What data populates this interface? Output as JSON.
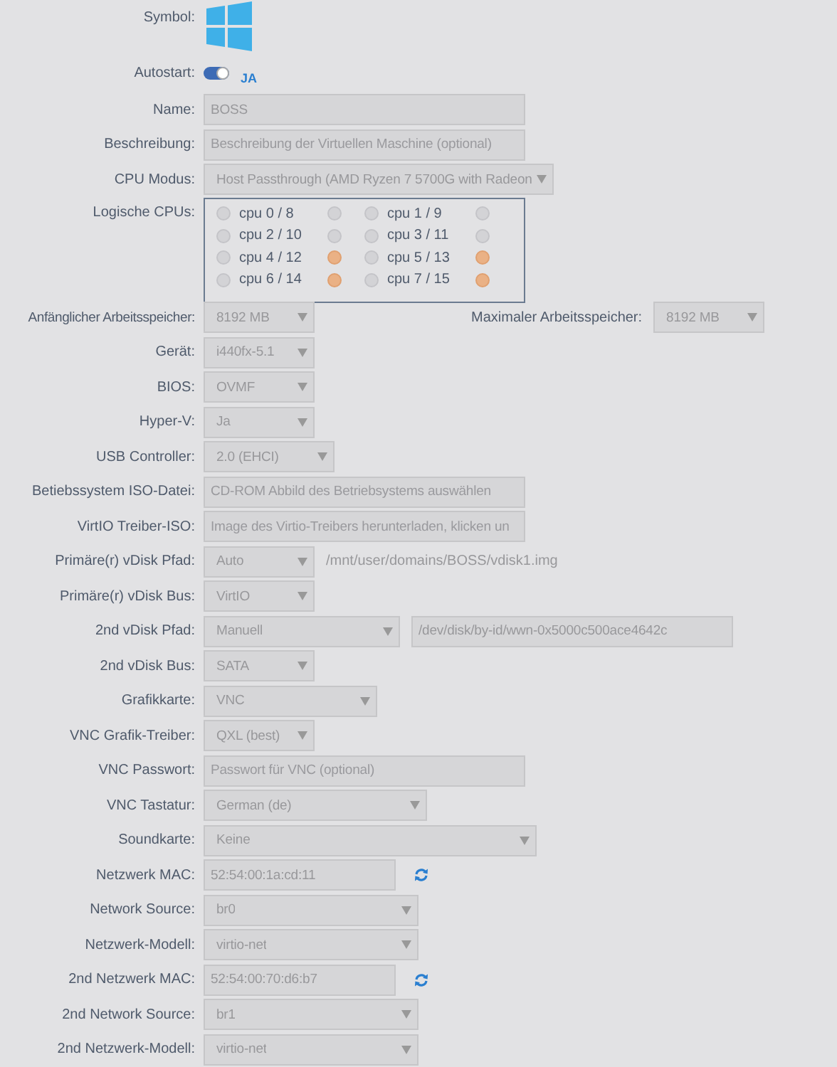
{
  "rows": [
    {
      "kind": "icon",
      "label": "Symbol:"
    },
    {
      "kind": "toggle",
      "label": "Autostart:",
      "on": true,
      "text": "JA"
    },
    {
      "kind": "text",
      "label": "Name:",
      "value": "BOSS"
    },
    {
      "kind": "text",
      "label": "Beschreibung:",
      "placeholder": "Beschreibung der Virtuellen Maschine (optional)"
    },
    {
      "kind": "select",
      "label": "CPU Modus:",
      "value": "Host Passthrough (AMD Ryzen 7 5700G with Radeon"
    },
    {
      "kind": "cpus",
      "label": "Logische CPUs:",
      "cpus": [
        {
          "label": "cpu 0 / 8",
          "first_checked": false,
          "second_checked": false
        },
        {
          "label": "cpu 1 / 9",
          "first_checked": false,
          "second_checked": false
        },
        {
          "label": "cpu 2 / 10",
          "first_checked": false,
          "second_checked": false
        },
        {
          "label": "cpu 3 / 11",
          "first_checked": false,
          "second_checked": false
        },
        {
          "label": "cpu 4 / 12",
          "first_checked": false,
          "second_checked": true
        },
        {
          "label": "cpu 5 / 13",
          "first_checked": false,
          "second_checked": true
        },
        {
          "label": "cpu 6 / 14",
          "first_checked": false,
          "second_checked": true
        },
        {
          "label": "cpu 7 / 15",
          "first_checked": false,
          "second_checked": true
        }
      ]
    },
    {
      "kind": "memory",
      "label": "Anfänglicher Arbeitsspeicher:",
      "value": "8192 MB",
      "second_label": "Maximaler Arbeitsspeicher:",
      "second_value": "8192 MB"
    },
    {
      "kind": "select",
      "label": "Gerät:",
      "value": "i440fx-5.1"
    },
    {
      "kind": "select",
      "label": "BIOS:",
      "value": "OVMF"
    },
    {
      "kind": "select",
      "label": "Hyper-V:",
      "value": "Ja"
    },
    {
      "kind": "select",
      "label": "USB Controller:",
      "value": "2.0 (EHCI)"
    },
    {
      "kind": "text",
      "label": "Betiebssystem ISO-Datei:",
      "placeholder": "CD-ROM Abbild des Betriebsystems auswählen"
    },
    {
      "kind": "text",
      "label": "VirtIO Treiber-ISO:",
      "placeholder": "Image des Virtio-Treibers herunterladen, klicken un"
    },
    {
      "kind": "select_path",
      "label": "Primäre(r) vDisk Pfad:",
      "value": "Auto",
      "path": "/mnt/user/domains/BOSS/vdisk1.img"
    },
    {
      "kind": "select",
      "label": "Primäre(r) vDisk Bus:",
      "value": "VirtIO"
    },
    {
      "kind": "select_input",
      "label": "2nd vDisk Pfad:",
      "value": "Manuell",
      "input_value": "/dev/disk/by-id/wwn-0x5000c500ace4642c"
    },
    {
      "kind": "select",
      "label": "2nd vDisk Bus:",
      "value": "SATA"
    },
    {
      "kind": "select",
      "label": "Grafikkarte:",
      "value": "VNC"
    },
    {
      "kind": "select",
      "label": "VNC Grafik-Treiber:",
      "value": "QXL (best)"
    },
    {
      "kind": "text",
      "label": "VNC Passwort:",
      "placeholder": "Passwort für VNC (optional)"
    },
    {
      "kind": "select",
      "label": "VNC Tastatur:",
      "value": "German (de)"
    },
    {
      "kind": "select",
      "label": "Soundkarte:",
      "value": "Keine"
    },
    {
      "kind": "mac",
      "label": "Netzwerk MAC:",
      "value": "52:54:00:1a:cd:11"
    },
    {
      "kind": "select",
      "label": "Network Source:",
      "value": "br0"
    },
    {
      "kind": "select",
      "label": "Netzwerk-Modell:",
      "value": "virtio-net"
    },
    {
      "kind": "mac",
      "label": "2nd Netzwerk MAC:",
      "value": "52:54:00:70:d6:b7"
    },
    {
      "kind": "select",
      "label": "2nd Network Source:",
      "value": "br1"
    },
    {
      "kind": "select",
      "label": "2nd Netzwerk-Modell:",
      "value": "virtio-net"
    }
  ]
}
